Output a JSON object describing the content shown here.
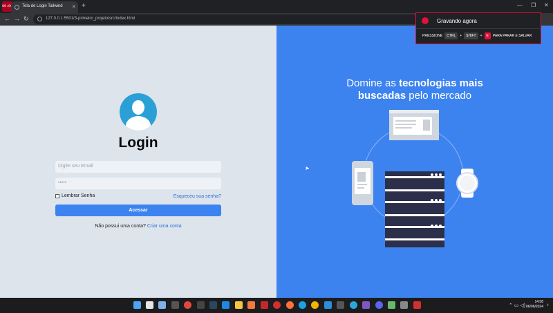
{
  "browser": {
    "rec_badge": "00:00",
    "tab_title": "Tela de Login Tailwind",
    "url": "127.0.0.1:5501/3-primeiro_projeto/src/index.html"
  },
  "recording": {
    "title": "Gravando agora",
    "press": "PRESSIONE",
    "key1": "CTRL",
    "key2": "SHIFT",
    "key3": "E",
    "suffix": "PARA PARAR E SALVAR",
    "plus": "+"
  },
  "login": {
    "title": "Login",
    "email_placeholder": "Digite seu Email",
    "password_value": "•••••",
    "remember_label": "Lembrar Senha",
    "forgot_link": "Esqueceu sua senha?",
    "submit_label": "Acessar",
    "no_account_text": "Não possui uma conta?",
    "signup_link": "Criar uma conta"
  },
  "hero": {
    "line1_plain": "Domine as",
    "line1_bold": "tecnologias mais",
    "line2_bold": "buscadas",
    "line2_plain": "pelo mercado"
  },
  "taskbar": {
    "time": "14:58",
    "date": "06/06/2024"
  },
  "colors": {
    "accent": "#3c83f0",
    "left_bg": "#dde4ec",
    "record_red": "#e0113a"
  }
}
